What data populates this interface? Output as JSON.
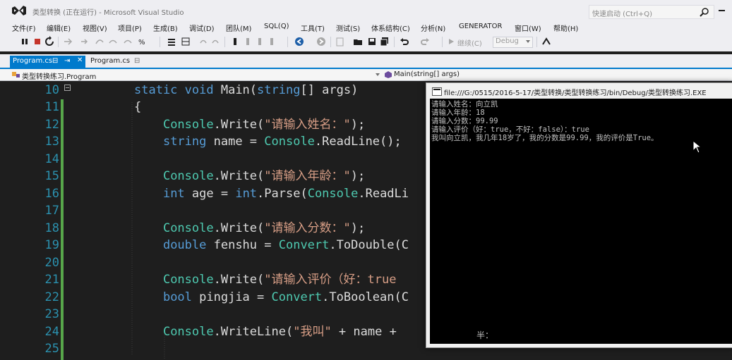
{
  "window": {
    "title": "类型转换 (正在运行) - Microsoft Visual Studio",
    "quick_launch": "快速启动 (Ctrl+Q)"
  },
  "menu": [
    "文件(F)",
    "编辑(E)",
    "视图(V)",
    "项目(P)",
    "生成(B)",
    "调试(D)",
    "团队(M)",
    "SQL(Q)",
    "工具(T)",
    "测试(S)",
    "体系结构(C)",
    "分析(N)",
    "GENERATOR",
    "窗口(W)",
    "帮助(H)"
  ],
  "toolbar": {
    "continue_label": "继续(C)",
    "config_value": "Debug"
  },
  "tabs": {
    "active": "Program.cs",
    "active_pin": "⊟",
    "active_pin2": "⇥",
    "close": "✕",
    "preview": "Program.cs",
    "preview_pin": "⊟"
  },
  "navbar": {
    "class_path": "类型转换练习.Program",
    "member": "Main(string[] args)"
  },
  "editor": {
    "line_numbers": [
      "10",
      "11",
      "12",
      "13",
      "14",
      "15",
      "16",
      "17",
      "18",
      "19",
      "20",
      "21",
      "22",
      "23",
      "24",
      "25"
    ]
  },
  "console": {
    "title": "file:///G:/0515/2016-5-17/类型转换/类型转换练习/bin/Debug/类型转换练习.EXE",
    "lines": [
      "请输入姓名：向立凯",
      "请输入年龄：18",
      "请输入分数：99.99",
      "请输入评价（好：true，不好：false）：true",
      "我叫向立凯，我几年18岁了，我的分数是99.99，我的评价是True。"
    ],
    "ime_status": "半："
  },
  "colors": {
    "accent": "#007acc",
    "keyword": "#569cd6",
    "type": "#4ec9b0",
    "string": "#d69d85",
    "line_number": "#2b91af",
    "change_marker": "#57a64a"
  }
}
